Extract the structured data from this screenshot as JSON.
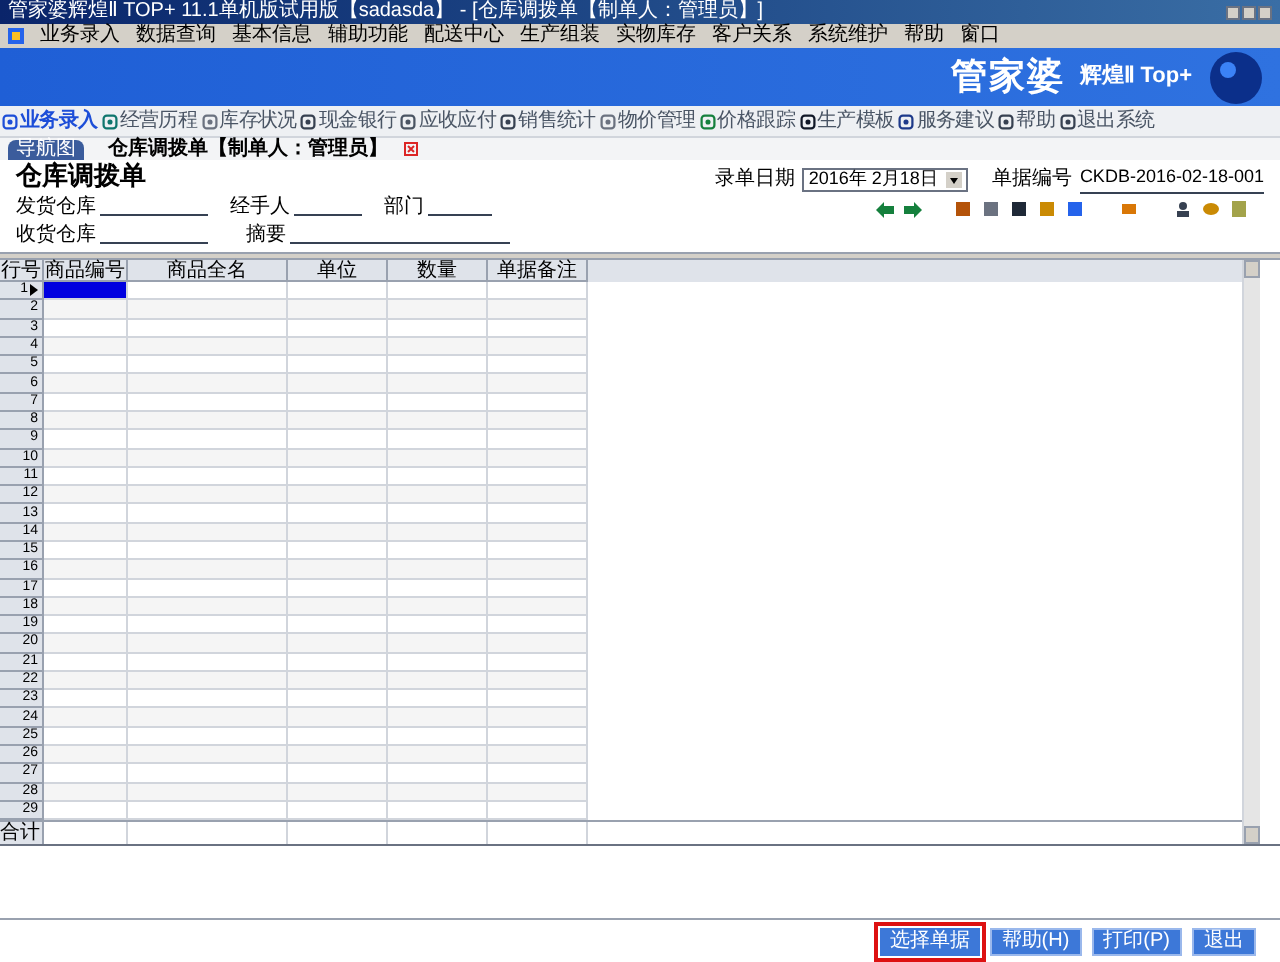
{
  "window": {
    "title": "管家婆辉煌Ⅱ TOP+ 11.1单机版试用版【sadasda】 - [仓库调拨单【制单人：管理员】]"
  },
  "menu": [
    "业务录入",
    "数据查询",
    "基本信息",
    "辅助功能",
    "配送中心",
    "生产组装",
    "实物库存",
    "客户关系",
    "系统维护",
    "帮助",
    "窗口"
  ],
  "banner": {
    "logo": "管家婆",
    "edition": "辉煌Ⅱ Top+"
  },
  "toolbar": [
    {
      "label": "业务录入",
      "selected": true
    },
    {
      "label": "经营历程",
      "selected": false
    },
    {
      "label": "库存状况",
      "selected": false
    },
    {
      "label": "现金银行",
      "selected": false
    },
    {
      "label": "应收应付",
      "selected": false
    },
    {
      "label": "销售统计",
      "selected": false
    },
    {
      "label": "物价管理",
      "selected": false
    },
    {
      "label": "价格跟踪",
      "selected": false
    },
    {
      "label": "生产模板",
      "selected": false
    },
    {
      "label": "服务建议",
      "selected": false
    },
    {
      "label": "帮助",
      "selected": false
    },
    {
      "label": "退出系统",
      "selected": false
    }
  ],
  "tabs": [
    {
      "label": "导航图",
      "selected": false
    },
    {
      "label": "仓库调拨单【制单人：管理员】",
      "selected": true
    }
  ],
  "form": {
    "title": "仓库调拨单",
    "fields_row_1": [
      "发货仓库",
      "经手人",
      "部门"
    ],
    "fields_row_2": [
      "收货仓库",
      "摘要"
    ],
    "date_label": "录单日期",
    "date_value": "2016年 2月18日",
    "number_label": "单据编号",
    "number_value": "CKDB-2016-02-18-001"
  },
  "table": {
    "columns": [
      "行号",
      "商品编号",
      "商品全名",
      "单位",
      "数量",
      "单据备注"
    ],
    "rows": [
      {
        "number": "1",
        "selected": true
      },
      {
        "number": "2",
        "selected": false
      },
      {
        "number": "3",
        "selected": false
      },
      {
        "number": "4",
        "selected": false
      },
      {
        "number": "5",
        "selected": false
      },
      {
        "number": "6",
        "selected": false
      },
      {
        "number": "7",
        "selected": false
      },
      {
        "number": "8",
        "selected": false
      },
      {
        "number": "9",
        "selected": false
      },
      {
        "number": "10",
        "selected": false
      },
      {
        "number": "11",
        "selected": false
      },
      {
        "number": "12",
        "selected": false
      },
      {
        "number": "13",
        "selected": false
      },
      {
        "number": "14",
        "selected": false
      },
      {
        "number": "15",
        "selected": false
      },
      {
        "number": "16",
        "selected": false
      },
      {
        "number": "17",
        "selected": false
      },
      {
        "number": "18",
        "selected": false
      },
      {
        "number": "19",
        "selected": false
      },
      {
        "number": "20",
        "selected": false
      },
      {
        "number": "21",
        "selected": false
      },
      {
        "number": "22",
        "selected": false
      },
      {
        "number": "23",
        "selected": false
      },
      {
        "number": "24",
        "selected": false
      },
      {
        "number": "25",
        "selected": false
      },
      {
        "number": "26",
        "selected": false
      },
      {
        "number": "27",
        "selected": false
      },
      {
        "number": "28",
        "selected": false
      },
      {
        "number": "29",
        "selected": false
      }
    ],
    "total_label": "合计"
  },
  "buttons": [
    {
      "label": "选择单据",
      "highlighted": true
    },
    {
      "label": "帮助(H)",
      "highlighted": false
    },
    {
      "label": "打印(P)",
      "highlighted": false
    },
    {
      "label": "退出",
      "highlighted": false
    }
  ]
}
